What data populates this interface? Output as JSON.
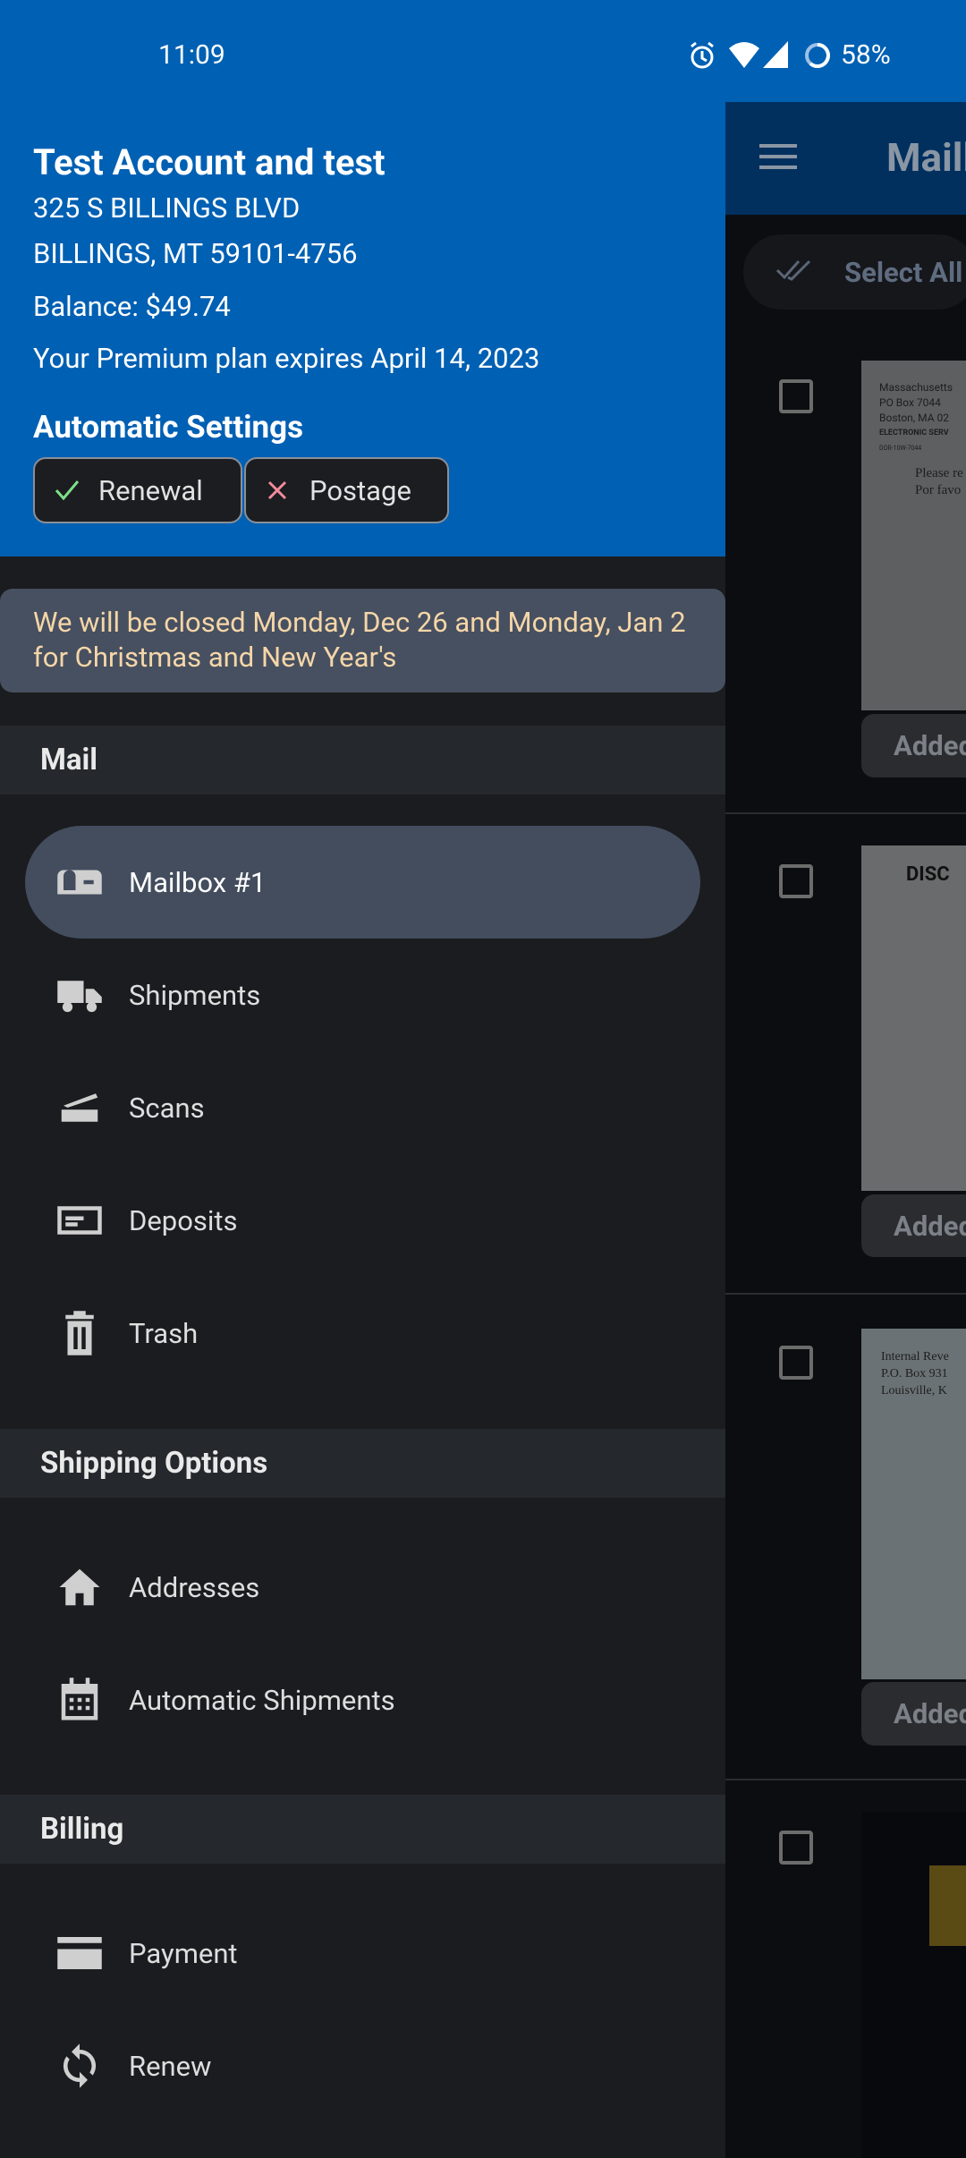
{
  "status_bar": {
    "time": "11:09",
    "battery": "58%",
    "icons": [
      "alarm-icon",
      "wifi-icon",
      "signal-icon",
      "battery-saver-icon"
    ]
  },
  "drawer": {
    "account_name": "Test Account and test",
    "address_line1": "325 S BILLINGS BLVD",
    "address_line2": "BILLINGS, MT 59101-4756",
    "balance": "Balance: $49.74",
    "plan": "Your Premium plan expires April 14, 2023",
    "auto_settings_title": "Automatic Settings",
    "chips": [
      {
        "label": "Renewal",
        "state": "on",
        "icon": "check-icon",
        "color": "#7ee08a"
      },
      {
        "label": "Postage",
        "state": "off",
        "icon": "x-icon",
        "color": "#f28b9b"
      }
    ],
    "notice": "We will be closed Monday, Dec 26 and Monday, Jan 2 for Christmas and New Year's",
    "sections": [
      {
        "title": "Mail",
        "items": [
          {
            "label": "Mailbox #1",
            "icon": "mailbox-icon",
            "selected": true
          },
          {
            "label": "Shipments",
            "icon": "truck-icon"
          },
          {
            "label": "Scans",
            "icon": "scanner-icon"
          },
          {
            "label": "Deposits",
            "icon": "check-deposit-icon"
          },
          {
            "label": "Trash",
            "icon": "trash-icon"
          }
        ]
      },
      {
        "title": "Shipping Options",
        "items": [
          {
            "label": "Addresses",
            "icon": "home-icon"
          },
          {
            "label": "Automatic Shipments",
            "icon": "calendar-icon"
          }
        ]
      },
      {
        "title": "Billing",
        "items": [
          {
            "label": "Payment",
            "icon": "credit-card-icon"
          },
          {
            "label": "Renew",
            "icon": "renew-icon"
          }
        ]
      }
    ]
  },
  "main": {
    "title": "Maill",
    "select_all": "Select All",
    "added_label": "Added",
    "envelope1": [
      "Massachusetts",
      "PO Box 7044",
      "Boston, MA 02",
      "ELECTRONIC SERV",
      "DOR-10W-7044",
      "Please re",
      "Por favo"
    ],
    "envelope2": "DISC",
    "envelope3": [
      "Internal Reve",
      "P.O. Box 931",
      "Louisville, K"
    ]
  },
  "colors": {
    "header_blue": "#0060b3",
    "drawer_bg": "#1b1c1f",
    "selected_bg": "#434d5e",
    "notice_text": "#f5d6a8"
  }
}
